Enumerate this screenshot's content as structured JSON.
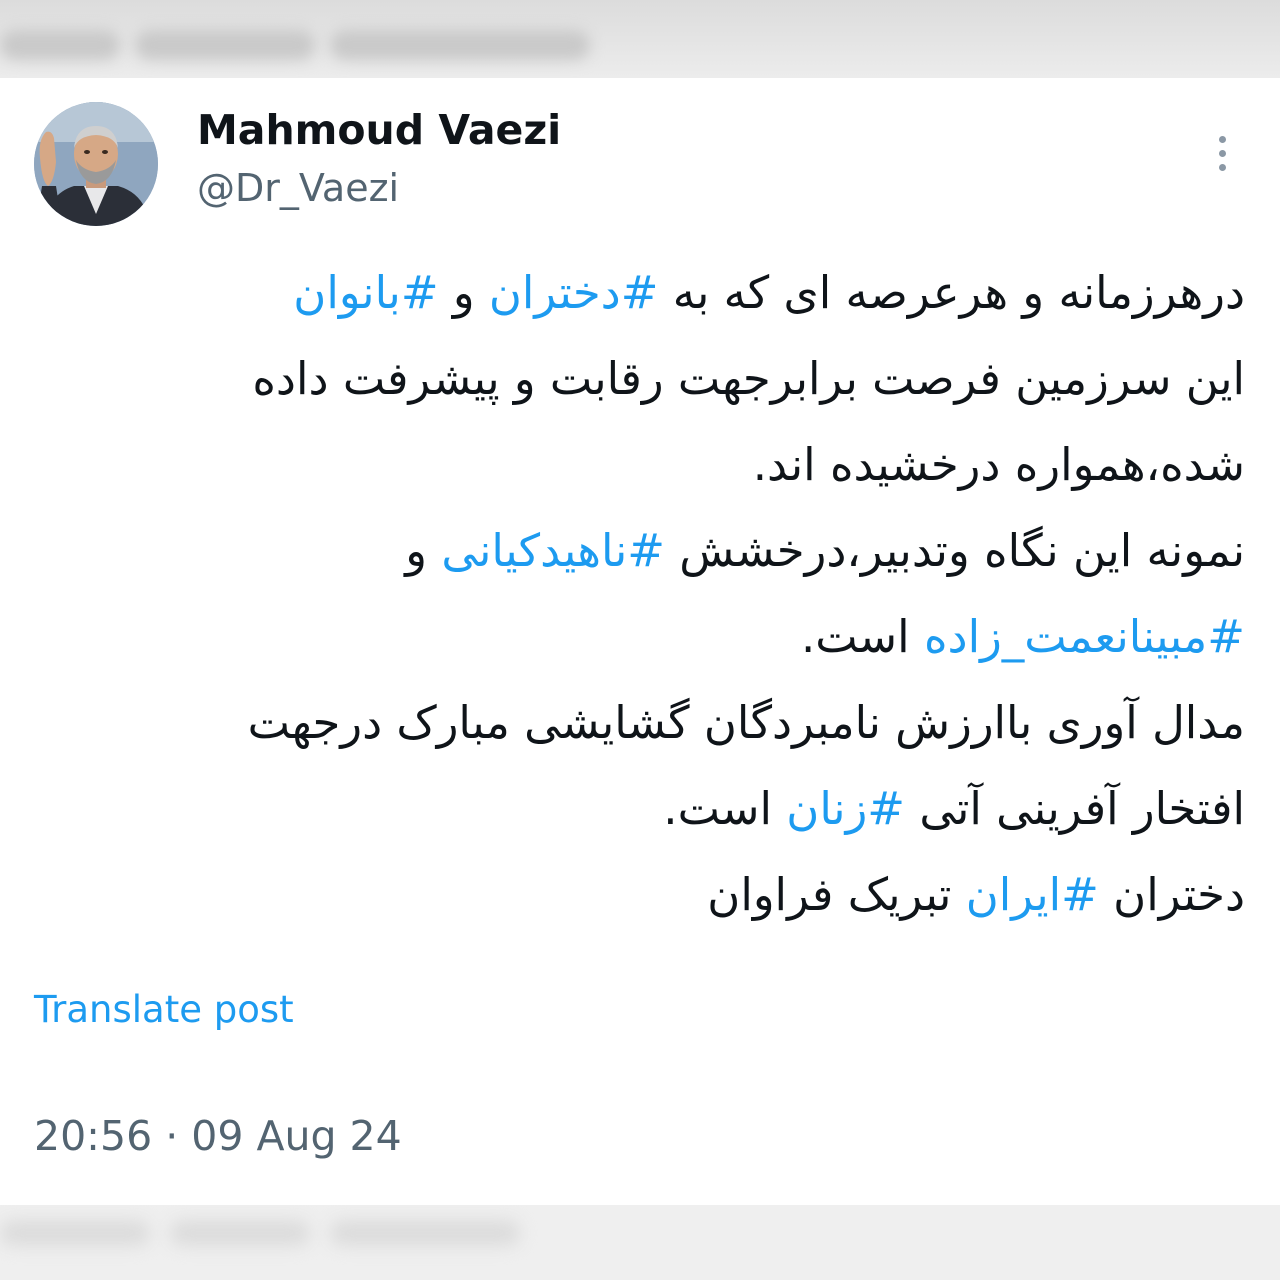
{
  "author": {
    "name": "Mahmoud Vaezi",
    "handle": "@Dr_Vaezi"
  },
  "post": {
    "lines": [
      [
        {
          "text": "درهرزمانه و هرعرصه ای که به ",
          "hashtag": false
        },
        {
          "text": "#دختران",
          "hashtag": true
        },
        {
          "text": " و ",
          "hashtag": false
        },
        {
          "text": "#بانوان",
          "hashtag": true
        }
      ],
      [
        {
          "text": "این سرزمین فرصت برابرجهت رقابت و پیشرفت داده",
          "hashtag": false
        }
      ],
      [
        {
          "text": "شده،همواره درخشیده اند.",
          "hashtag": false
        }
      ],
      [
        {
          "text": "نمونه این نگاه وتدبیر،درخشش ",
          "hashtag": false
        },
        {
          "text": "#ناهیدکیانی",
          "hashtag": true
        },
        {
          "text": " و",
          "hashtag": false
        }
      ],
      [
        {
          "text": "#مبینانعمت_زاده",
          "hashtag": true
        },
        {
          "text": " است.",
          "hashtag": false
        }
      ],
      [
        {
          "text": "مدال آوری باارزش نامبردگان گشایشی مبارک درجهت",
          "hashtag": false
        }
      ],
      [
        {
          "text": "افتخار آفرینی آتی ",
          "hashtag": false
        },
        {
          "text": "#زنان",
          "hashtag": true
        },
        {
          "text": " است.",
          "hashtag": false
        }
      ],
      [
        {
          "text": "دختران ",
          "hashtag": false
        },
        {
          "text": "#ایران",
          "hashtag": true
        },
        {
          "text": " تبریک فراوان",
          "hashtag": false
        }
      ]
    ]
  },
  "translate_label": "Translate post",
  "timestamp": "20:56 · 09 Aug 24",
  "icons": {
    "more": "more-vertical-icon",
    "avatar": "avatar-photo"
  },
  "colors": {
    "hashtag": "#1d9bf0",
    "text": "#0f1419",
    "secondary": "#536471",
    "background": "#ffffff"
  }
}
